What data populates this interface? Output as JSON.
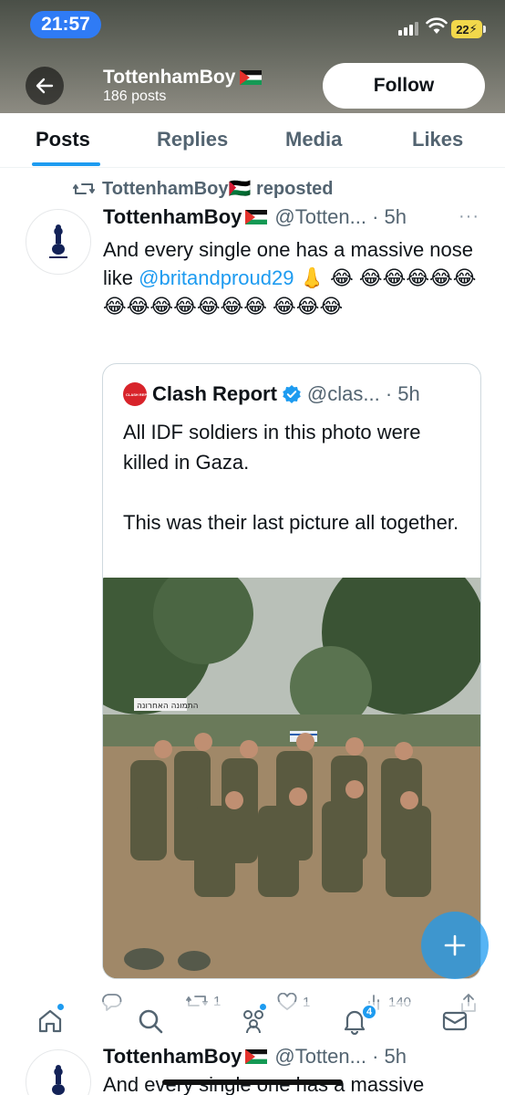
{
  "status_bar": {
    "time": "21:57",
    "battery": "22"
  },
  "profile_header": {
    "name": "TottenhamBoy",
    "posts_count": "186 posts",
    "follow_label": "Follow"
  },
  "tabs": [
    {
      "label": "Posts",
      "active": true
    },
    {
      "label": "Replies",
      "active": false
    },
    {
      "label": "Media",
      "active": false
    },
    {
      "label": "Likes",
      "active": false
    }
  ],
  "tweet": {
    "repost_label": "TottenhamBoy🇵🇸 reposted",
    "author_name": "TottenhamBoy",
    "handle_time": "@Totten... · 5h",
    "more_icon": "···",
    "text_before": "And every single one has a massive nose like ",
    "mention": "@britandproud29",
    "text_after": " 👃 😂 😂😂😂😂😂😂😂😂😂😂😂😂 😂😂😂",
    "quote": {
      "logo_text": "CLASH REPORT",
      "name": "Clash Report",
      "handle_time": "@clas... · 5h",
      "text_line1": "All IDF soldiers in this photo were killed in Gaza.",
      "text_line2": "This was their last picture all together.",
      "photo_caption": "התמונה האחרונה"
    },
    "actions": {
      "replies": "",
      "reposts": "1",
      "likes": "1",
      "views": "140"
    }
  },
  "bottom_nav": {
    "notifications_badge": "4"
  },
  "next_tweet": {
    "author_name": "TottenhamBoy",
    "handle_time": "@Totten... · 5h",
    "text_preview": "And every single one has a massive"
  },
  "colors": {
    "accent": "#1d9bf0",
    "text": "#0f1419",
    "muted": "#536471",
    "status_pill": "#2f7bf5"
  }
}
